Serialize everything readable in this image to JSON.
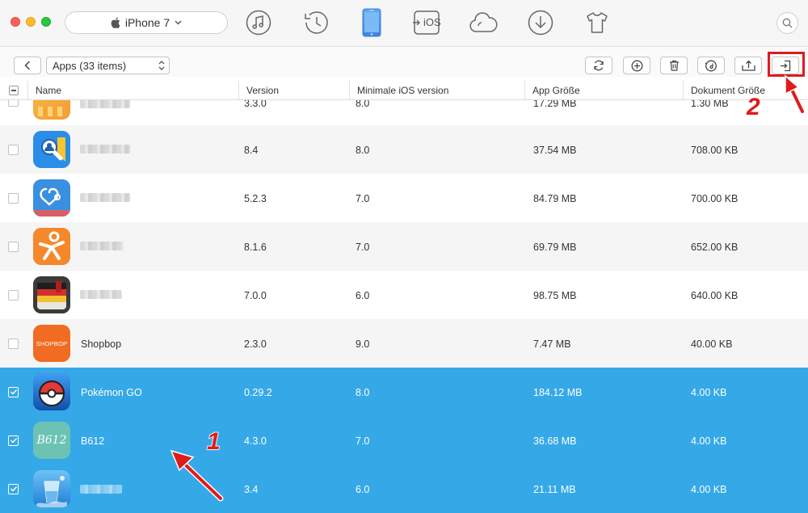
{
  "titlebar": {
    "device_name": "iPhone 7",
    "nav_icons": [
      "music-icon",
      "history-icon",
      "iphone-icon",
      "ios-transfer-icon",
      "cloud-icon",
      "download-icon",
      "tshirt-icon"
    ],
    "ios_icon_label": "iOS",
    "active_nav": "iphone-icon"
  },
  "toolbar": {
    "category": "Apps (33 items)",
    "actions": [
      "refresh-icon",
      "add-icon",
      "delete-icon",
      "reinstall-icon",
      "to-computer-icon",
      "export-icon"
    ]
  },
  "table": {
    "columns": [
      "Name",
      "Version",
      "Minimale iOS version",
      "App Größe",
      "Dokument Größe"
    ],
    "rows": [
      {
        "name": "",
        "version": "3.3.0",
        "min_ios": "8.0",
        "app_size": "17.29 MB",
        "doc_size": "1.30 MB",
        "selected": false
      },
      {
        "name": "",
        "version": "8.4",
        "min_ios": "8.0",
        "app_size": "37.54 MB",
        "doc_size": "708.00 KB",
        "selected": false
      },
      {
        "name": "",
        "version": "5.2.3",
        "min_ios": "7.0",
        "app_size": "84.79 MB",
        "doc_size": "700.00 KB",
        "selected": false
      },
      {
        "name": "",
        "version": "8.1.6",
        "min_ios": "7.0",
        "app_size": "69.79 MB",
        "doc_size": "652.00 KB",
        "selected": false
      },
      {
        "name": "",
        "version": "7.0.0",
        "min_ios": "6.0",
        "app_size": "98.75 MB",
        "doc_size": "640.00 KB",
        "selected": false
      },
      {
        "name": "Shopbop",
        "version": "2.3.0",
        "min_ios": "9.0",
        "app_size": "7.47 MB",
        "doc_size": "40.00 KB",
        "selected": false
      },
      {
        "name": "Pokémon GO",
        "version": "0.29.2",
        "min_ios": "8.0",
        "app_size": "184.12 MB",
        "doc_size": "4.00 KB",
        "selected": true
      },
      {
        "name": "B612",
        "version": "4.3.0",
        "min_ios": "7.0",
        "app_size": "36.68 MB",
        "doc_size": "4.00 KB",
        "selected": true
      },
      {
        "name": "",
        "version": "3.4",
        "min_ios": "6.0",
        "app_size": "21.11 MB",
        "doc_size": "4.00 KB",
        "selected": true
      }
    ],
    "icon_texts": {
      "shopbop": "SHOPBOP",
      "b612": "B612"
    }
  },
  "annotations": {
    "step1": "1",
    "step2": "2"
  },
  "colors": {
    "selection": "#35a8e8",
    "accent": "#4a90e2",
    "annotation": "#e01b1b"
  }
}
